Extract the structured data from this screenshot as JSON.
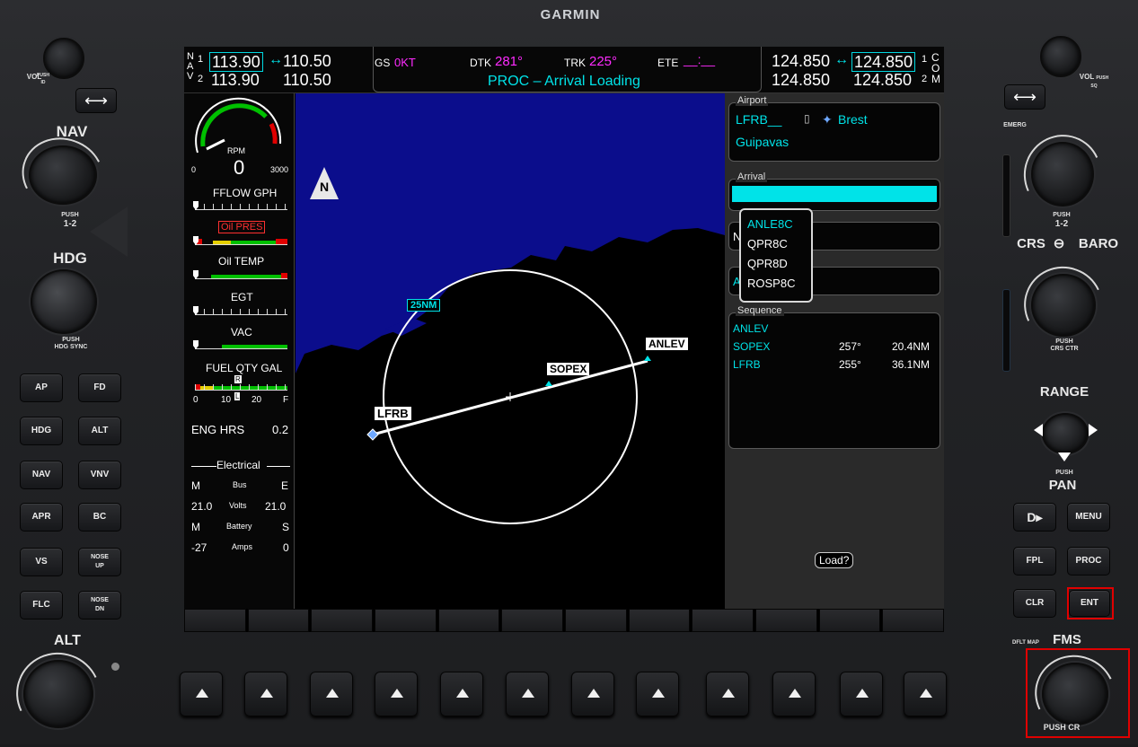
{
  "brand": "GARMIN",
  "left_panel": {
    "vol_label": "VOL",
    "vol_push": "PUSH\nID",
    "nav_label": "NAV",
    "nav_push": "PUSH",
    "nav_12": "1-2",
    "hdg_label": "HDG",
    "hdg_push": "PUSH\nHDG SYNC",
    "alt_label": "ALT",
    "buttons": [
      {
        "id": "ap",
        "label": "AP"
      },
      {
        "id": "fd",
        "label": "FD"
      },
      {
        "id": "hdg",
        "label": "HDG"
      },
      {
        "id": "alt",
        "label": "ALT"
      },
      {
        "id": "nav",
        "label": "NAV"
      },
      {
        "id": "vnv",
        "label": "VNV"
      },
      {
        "id": "apr",
        "label": "APR"
      },
      {
        "id": "bc",
        "label": "BC"
      },
      {
        "id": "vs",
        "label": "VS"
      },
      {
        "id": "noseup",
        "label": "NOSE\nUP"
      },
      {
        "id": "flc",
        "label": "FLC"
      },
      {
        "id": "nosedn",
        "label": "NOSE\nDN"
      }
    ]
  },
  "right_panel": {
    "vol_label": "VOL",
    "vol_push": "PUSH\nSQ",
    "emerg": "EMERG",
    "com_push": "PUSH",
    "com_12": "1-2",
    "crs_baro": "CRS",
    "baro": "BARO",
    "crs_push": "PUSH\nCRS CTR",
    "range": "RANGE",
    "range_push": "PUSH",
    "pan": "PAN",
    "direct": "D▸",
    "menu": "MENU",
    "fpl": "FPL",
    "proc": "PROC",
    "clr": "CLR",
    "ent": "ENT",
    "dfltmap": "DFLT MAP",
    "fms": "FMS",
    "fms_push": "PUSH CR"
  },
  "topbar": {
    "nav_letters": [
      "N",
      "A",
      "V"
    ],
    "nav1_idx": "1",
    "nav2_idx": "2",
    "nav1_active": "113.90",
    "nav1_standby": "110.50",
    "nav2_active": "113.90",
    "nav2_standby": "110.50",
    "gs_label": "GS",
    "gs_value": "0KT",
    "dtk_label": "DTK",
    "dtk_value": "281°",
    "trk_label": "TRK",
    "trk_value": "225°",
    "ete_label": "ETE",
    "ete_value": "__:__",
    "message": "PROC – Arrival Loading",
    "com1_active": "124.850",
    "com1_standby": "124.850",
    "com2_active": "124.850",
    "com2_standby": "124.850",
    "com_idx1": "1",
    "com_idx2": "2",
    "com_letters": [
      "C",
      "O",
      "M"
    ]
  },
  "eis": {
    "rpm_label": "RPM",
    "rpm_value": "0",
    "rpm_min": "0",
    "rpm_max": "3000",
    "fflow": "FFLOW GPH",
    "oil_pres": "Oil PRES",
    "oil_temp": "Oil TEMP",
    "egt": "EGT",
    "vac": "VAC",
    "fuel": "FUEL QTY GAL",
    "fuel_ticks": [
      "0",
      "10",
      "20",
      "F"
    ],
    "fuel_r": "R",
    "fuel_l": "L",
    "eng_hrs_label": "ENG HRS",
    "eng_hrs_value": "0.2",
    "electrical": "Electrical",
    "m1": "M",
    "bus": "Bus",
    "e": "E",
    "volts_m": "21.0",
    "volts": "Volts",
    "volts_e": "21.0",
    "m2": "M",
    "battery": "Battery",
    "s": "S",
    "amps_m": "-27",
    "amps": "Amps",
    "amps_s": "0"
  },
  "map": {
    "north": "N",
    "range_ring": "25NM",
    "waypoints": [
      "LFRB",
      "SOPEX",
      "ANLEV"
    ]
  },
  "fms": {
    "airport_title": "Airport",
    "airport_id": "LFRB__",
    "airport_city": "Brest",
    "airport_name": "Guipavas",
    "arrival_title": "Arrival",
    "row3_initial": "N",
    "row4_initial": "A",
    "dropdown": [
      "ANLE8C",
      "QPR8C",
      "QPR8D",
      "ROSP8C"
    ],
    "sequence_title": "Sequence",
    "sequence": [
      {
        "wpt": "ANLEV",
        "dtk": "",
        "dist": ""
      },
      {
        "wpt": "SOPEX",
        "dtk": "257°",
        "dist": "20.4NM"
      },
      {
        "wpt": "LFRB",
        "dtk": "255°",
        "dist": "36.1NM"
      }
    ],
    "load": "Load?"
  },
  "colors": {
    "cyan": "#00e3e8",
    "magenta": "#ff2bff",
    "map_blue": "#0b0d8c",
    "highlight": "#00e3e8"
  }
}
